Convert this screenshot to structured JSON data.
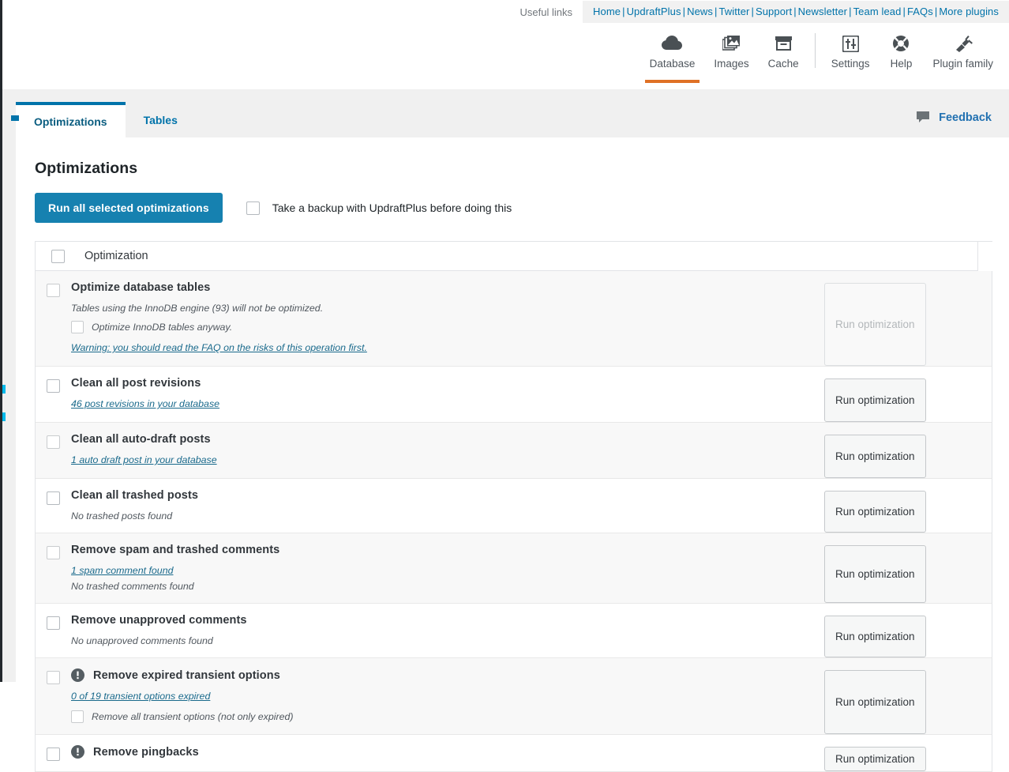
{
  "useful_links": {
    "label": "Useful links",
    "items": [
      "Home",
      "UpdraftPlus",
      "News",
      "Twitter",
      "Support",
      "Newsletter",
      "Team lead",
      "FAQs",
      "More plugins"
    ],
    "separator": "|"
  },
  "top_nav": {
    "items": [
      {
        "label": "Database",
        "icon": "cloud-icon",
        "active": true
      },
      {
        "label": "Images",
        "icon": "images-icon",
        "active": false
      },
      {
        "label": "Cache",
        "icon": "cache-box-icon",
        "active": false
      },
      {
        "label": "Settings",
        "icon": "settings-sliders-icon",
        "active": false
      },
      {
        "label": "Help",
        "icon": "life-ring-icon",
        "active": false
      },
      {
        "label": "Plugin family",
        "icon": "plug-icon",
        "active": false
      }
    ],
    "active_underline_color": "#df7125"
  },
  "tabs": {
    "items": [
      {
        "label": "Optimizations",
        "active": true
      },
      {
        "label": "Tables",
        "active": false
      }
    ],
    "accent_color": "#0073aa"
  },
  "feedback": {
    "label": "Feedback",
    "icon": "comment-icon"
  },
  "main": {
    "title": "Optimizations",
    "run_all_label": "Run all selected optimizations",
    "run_all_color": "#1681b0",
    "backup_checkbox_label": "Take a backup with UpdraftPlus before doing this",
    "backup_checked": false,
    "table_header": {
      "label": "Optimization",
      "checked": false
    },
    "rows": [
      {
        "title": "Optimize database tables",
        "warn": false,
        "checked": false,
        "note": "Tables using the InnoDB engine (93) will not be optimized.",
        "sub_check_label": "Optimize InnoDB tables anyway.",
        "sub_checked": false,
        "link": "Warning: you should read the FAQ on the risks of this operation first.",
        "button_label": "Run optimization",
        "button_disabled": true,
        "alt": true
      },
      {
        "title": "Clean all post revisions",
        "warn": false,
        "checked": false,
        "link": "46 post revisions in your database",
        "button_label": "Run optimization",
        "button_disabled": false,
        "alt": false
      },
      {
        "title": "Clean all auto-draft posts",
        "warn": false,
        "checked": false,
        "link": "1 auto draft post in your database",
        "button_label": "Run optimization",
        "button_disabled": false,
        "alt": true
      },
      {
        "title": "Clean all trashed posts",
        "warn": false,
        "checked": false,
        "note": "No trashed posts found",
        "button_label": "Run optimization",
        "button_disabled": false,
        "alt": false
      },
      {
        "title": "Remove spam and trashed comments",
        "warn": false,
        "checked": false,
        "link": "1 spam comment found",
        "note2": "No trashed comments found",
        "button_label": "Run optimization",
        "button_disabled": false,
        "alt": true
      },
      {
        "title": "Remove unapproved comments",
        "warn": false,
        "checked": false,
        "note": "No unapproved comments found",
        "button_label": "Run optimization",
        "button_disabled": false,
        "alt": false
      },
      {
        "title": "Remove expired transient options",
        "warn": true,
        "checked": false,
        "link": "0 of 19 transient options expired",
        "sub_check_label": "Remove all transient options (not only expired)",
        "sub_checked": false,
        "button_label": "Run optimization",
        "button_disabled": false,
        "alt": true
      },
      {
        "title": "Remove pingbacks",
        "warn": true,
        "checked": false,
        "button_label": "Run optimization",
        "button_disabled": false,
        "alt": false
      }
    ]
  }
}
